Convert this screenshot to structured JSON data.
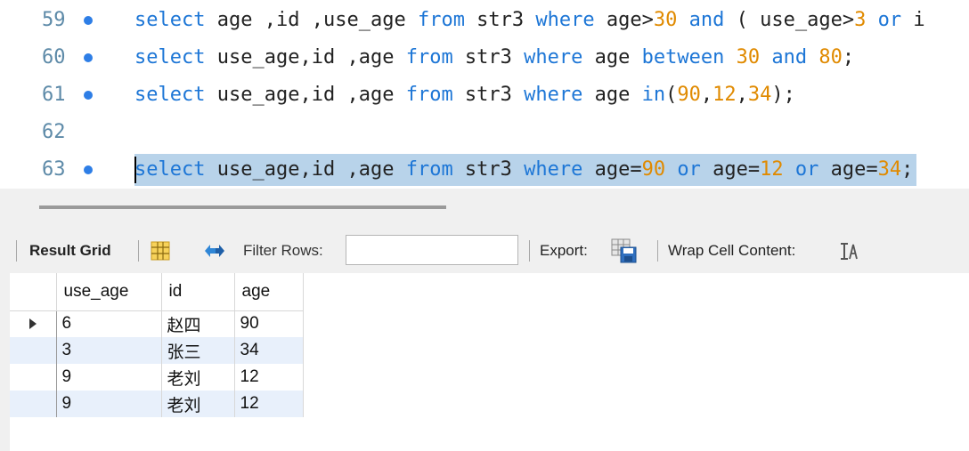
{
  "editor": {
    "lines": [
      {
        "number": "59",
        "sql": "select age ,id ,use_age from str3 where age>30 and ( use_age>3 or i"
      },
      {
        "number": "60",
        "sql": "select use_age,id ,age from str3 where age between 30 and 80;"
      },
      {
        "number": "61",
        "sql": "select use_age,id ,age from str3 where age in(90,12,34);"
      },
      {
        "number": "62",
        "sql": ""
      },
      {
        "number": "63",
        "sql": "select use_age,id ,age from str3 where age=90 or age=12 or age=34;"
      }
    ],
    "keywords": [
      "select",
      "from",
      "where",
      "and",
      "or",
      "between",
      "in"
    ],
    "colors": {
      "keyword": "#1d76d6",
      "number": "#e08a00",
      "line_number": "#5d8aa8",
      "execution_dot": "#2e7ee6",
      "selection": "#b8d3ea"
    }
  },
  "toolbar": {
    "result_grid_label": "Result Grid",
    "grid_view_icon": "grid-view-icon",
    "refresh_icon": "refresh-icon",
    "filter_label": "Filter Rows:",
    "filter_value": "",
    "export_label": "Export:",
    "export_icon": "export-icon",
    "wrap_label": "Wrap Cell Content:",
    "wrap_icon": "wrap-cell-icon"
  },
  "grid": {
    "columns": [
      "use_age",
      "id",
      "age"
    ],
    "rows": [
      [
        "6",
        "赵四",
        "90"
      ],
      [
        "3",
        "张三",
        "34"
      ],
      [
        "9",
        "老刘",
        "12"
      ],
      [
        "9",
        "老刘",
        "12"
      ]
    ],
    "colors": {
      "alternate_row": "#e8f0fb"
    }
  }
}
